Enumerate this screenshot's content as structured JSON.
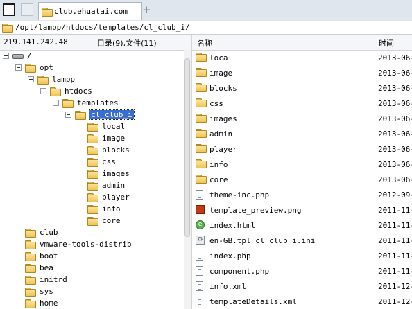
{
  "tab": {
    "title": "club.ehuatai.com"
  },
  "tab_new_glyph": "+",
  "path": "/opt/lampp/htdocs/templates/cl_club_i/",
  "header": {
    "host": "219.141.242.48",
    "summary": "目录(9),文件(11)",
    "col_name": "名称",
    "col_time": "时间"
  },
  "tree": [
    {
      "label": "/",
      "icon": "drive-icon",
      "expanded": true
    },
    {
      "label": "opt",
      "icon": "folder-icon",
      "expanded": true
    },
    {
      "label": "lampp",
      "icon": "folder-icon",
      "expanded": true
    },
    {
      "label": "htdocs",
      "icon": "folder-icon",
      "expanded": true
    },
    {
      "label": "templates",
      "icon": "folder-icon",
      "expanded": true
    },
    {
      "label": "cl_club_i",
      "icon": "folder-icon",
      "expanded": true,
      "selected": true
    },
    {
      "label": "local",
      "icon": "folder-icon"
    },
    {
      "label": "image",
      "icon": "folder-icon"
    },
    {
      "label": "blocks",
      "icon": "folder-icon"
    },
    {
      "label": "css",
      "icon": "folder-icon"
    },
    {
      "label": "images",
      "icon": "folder-icon"
    },
    {
      "label": "admin",
      "icon": "folder-icon"
    },
    {
      "label": "player",
      "icon": "folder-icon"
    },
    {
      "label": "info",
      "icon": "folder-icon"
    },
    {
      "label": "core",
      "icon": "folder-icon"
    },
    {
      "label": "club",
      "icon": "folder-icon"
    },
    {
      "label": "vmware-tools-distrib",
      "icon": "folder-icon"
    },
    {
      "label": "boot",
      "icon": "folder-icon"
    },
    {
      "label": "bea",
      "icon": "folder-icon"
    },
    {
      "label": "initrd",
      "icon": "folder-icon"
    },
    {
      "label": "sys",
      "icon": "folder-icon"
    },
    {
      "label": "home",
      "icon": "folder-icon"
    }
  ],
  "files": [
    {
      "name": "local",
      "time": "2013-06-",
      "icon": "folder-icon"
    },
    {
      "name": "image",
      "time": "2013-06-",
      "icon": "folder-icon"
    },
    {
      "name": "blocks",
      "time": "2013-06-",
      "icon": "folder-icon"
    },
    {
      "name": "css",
      "time": "2013-06-",
      "icon": "folder-icon"
    },
    {
      "name": "images",
      "time": "2013-06-",
      "icon": "folder-icon"
    },
    {
      "name": "admin",
      "time": "2013-06-",
      "icon": "folder-icon"
    },
    {
      "name": "player",
      "time": "2013-06-",
      "icon": "folder-icon"
    },
    {
      "name": "info",
      "time": "2013-06-",
      "icon": "folder-icon"
    },
    {
      "name": "core",
      "time": "2013-06-",
      "icon": "folder-icon"
    },
    {
      "name": "theme-inc.php",
      "time": "2012-09-",
      "icon": "php-file-icon"
    },
    {
      "name": "template_preview.png",
      "time": "2011-11-",
      "icon": "image-file-icon"
    },
    {
      "name": "index.html",
      "time": "2011-11-",
      "icon": "html-file-icon"
    },
    {
      "name": "en-GB.tpl_cl_club_i.ini",
      "time": "2011-11-",
      "icon": "ini-file-icon"
    },
    {
      "name": "index.php",
      "time": "2011-11-",
      "icon": "php-file-icon"
    },
    {
      "name": "component.php",
      "time": "2011-11-",
      "icon": "php-file-icon"
    },
    {
      "name": "info.xml",
      "time": "2011-12-",
      "icon": "xml-file-icon"
    },
    {
      "name": "templateDetails.xml",
      "time": "2011-12-",
      "icon": "xml-file-icon"
    }
  ]
}
